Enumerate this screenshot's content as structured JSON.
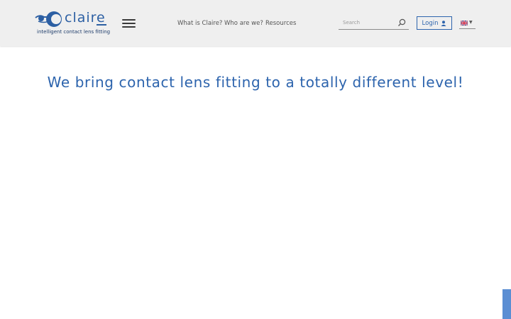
{
  "brand": {
    "name": "claire",
    "tagline": "intelligent contact lens fitting",
    "color": "#2c5fa3"
  },
  "header": {
    "menu_icon": "hamburger-icon",
    "nav": [
      {
        "label": "What is Claire?"
      },
      {
        "label": "Who are we?"
      },
      {
        "label": "Resources"
      }
    ],
    "search": {
      "placeholder": "Search",
      "value": "",
      "icon": "search-icon"
    },
    "login": {
      "label": "Login",
      "icon": "user-icon"
    },
    "language": {
      "icon": "uk-flag-icon",
      "caret": "▼"
    }
  },
  "hero": {
    "title": "We bring contact lens fitting to a totally different level!"
  },
  "colors": {
    "accent": "#2d64ad",
    "header_bg": "#efefef",
    "side_tab": "#5b8ed3"
  }
}
